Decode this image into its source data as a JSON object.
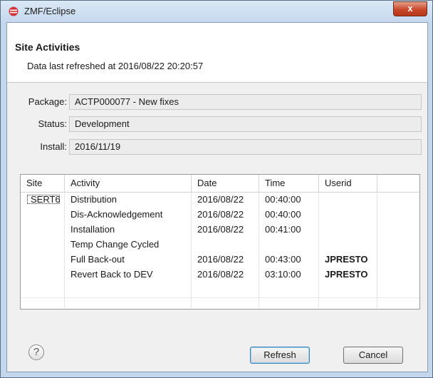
{
  "window": {
    "title": "ZMF/Eclipse",
    "close_label": "x"
  },
  "header": {
    "title": "Site Activities",
    "refresh_message": "Data last refreshed at 2016/08/22 20:20:57"
  },
  "form": {
    "package": {
      "label": "Package:",
      "value": "ACTP000077 - New fixes"
    },
    "status": {
      "label": "Status:",
      "value": "Development"
    },
    "install": {
      "label": "Install:",
      "value": "2016/11/19"
    }
  },
  "table": {
    "columns": [
      "Site",
      "Activity",
      "Date",
      "Time",
      "Userid"
    ],
    "rows": [
      {
        "site": "SERT6",
        "activity": "Distribution",
        "date": "2016/08/22",
        "time": "00:40:00",
        "userid": ""
      },
      {
        "site": "",
        "activity": "Dis-Acknowledgement",
        "date": "2016/08/22",
        "time": "00:40:00",
        "userid": ""
      },
      {
        "site": "",
        "activity": "Installation",
        "date": "2016/08/22",
        "time": "00:41:00",
        "userid": ""
      },
      {
        "site": "",
        "activity": "Temp Change Cycled",
        "date": "",
        "time": "",
        "userid": ""
      },
      {
        "site": "",
        "activity": "Full Back-out",
        "date": "2016/08/22",
        "time": "00:43:00",
        "userid": "JPRESTO"
      },
      {
        "site": "",
        "activity": "Revert Back to DEV",
        "date": "2016/08/22",
        "time": "03:10:00",
        "userid": "JPRESTO"
      }
    ]
  },
  "footer": {
    "help_icon": "question-mark",
    "refresh_label": "Refresh",
    "cancel_label": "Cancel"
  },
  "colors": {
    "frame": "#c2d6ec",
    "close_button": "#c8472a",
    "default_button_border": "#3c7fb1"
  }
}
